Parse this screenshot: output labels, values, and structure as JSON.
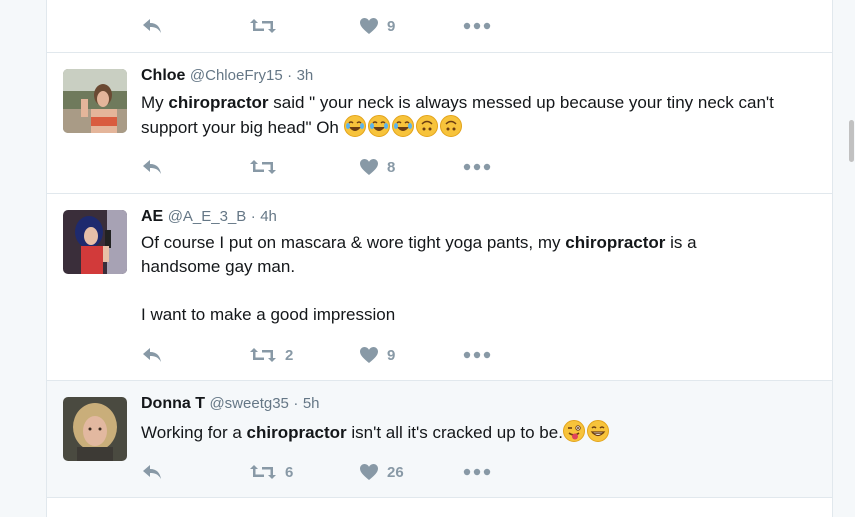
{
  "tweets": [
    {
      "id": "t0",
      "fullname": "",
      "username": "",
      "time": "",
      "text_parts": [],
      "replies": "",
      "retweets": "",
      "likes": "9"
    },
    {
      "id": "t1",
      "fullname": "Chloe",
      "username": "@ChloeFry15",
      "time": "3h",
      "text_before": "My ",
      "keyword": "chiropractor",
      "text_after": " said \" your neck is always messed up because your tiny neck can't support your big head\" Oh ",
      "emojis": [
        "joy-emoji",
        "joy-emoji",
        "joy-emoji",
        "upside-down-face-emoji",
        "upside-down-face-emoji"
      ],
      "retweets": "",
      "likes": "8"
    },
    {
      "id": "t2",
      "fullname": "AE",
      "username": "@A_E_3_B",
      "time": "4h",
      "text_before": "Of course I put on mascara & wore tight yoga pants, my ",
      "keyword": "chiropractor",
      "text_after": " is a handsome gay man.",
      "text_line2": "I want to make a good impression",
      "retweets": "2",
      "likes": "9"
    },
    {
      "id": "t3",
      "fullname": "Donna T",
      "username": "@sweetg35",
      "time": "5h",
      "text_before": "Working for a ",
      "keyword": "chiropractor",
      "text_after": " isn't all it's cracked up to be.",
      "emojis": [
        "winking-tongue-emoji",
        "grinning-emoji"
      ],
      "retweets": "6",
      "likes": "26"
    }
  ],
  "icons": {
    "reply": "reply-icon",
    "retweet": "retweet-icon",
    "like": "heart-icon",
    "more": "more-dots-icon"
  },
  "colors": {
    "action_gray": "#8899a6",
    "meta_gray": "#657786",
    "border": "#e1e8ed",
    "hover_bg": "#f5f8fa"
  },
  "separator": "·"
}
